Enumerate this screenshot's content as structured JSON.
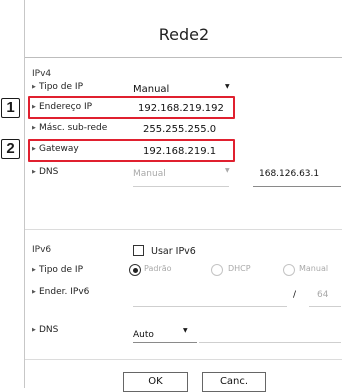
{
  "title": "Rede2",
  "ipv4": {
    "section_label": "IPv4",
    "ip_type": {
      "label": "Tipo de IP",
      "value": "Manual"
    },
    "ip_address": {
      "label": "Endereço IP",
      "value": "192.168.219.192"
    },
    "subnet_mask": {
      "label": "Másc. sub-rede",
      "value": "255.255.255.0"
    },
    "gateway": {
      "label": "Gateway",
      "value": "192.168.219.1"
    },
    "dns": {
      "label": "DNS",
      "mode": "Manual",
      "value": "168.126.63.1"
    }
  },
  "callouts": {
    "one": "1",
    "two": "2"
  },
  "ipv6": {
    "section_label": "IPv6",
    "use_label": "Usar IPv6",
    "use_checked": false,
    "ip_type": {
      "label": "Tipo de IP",
      "options": [
        "Padrão",
        "DHCP",
        "Manual"
      ],
      "selected": "Padrão"
    },
    "address": {
      "label": "Ender. IPv6",
      "value": "",
      "prefix_separator": "/",
      "prefix": "64"
    },
    "dns": {
      "label": "DNS",
      "value": "Auto"
    }
  },
  "buttons": {
    "ok": "OK",
    "cancel": "Canc."
  },
  "icons": {
    "dropdown": "chevron-down-icon",
    "bullet": "triangle-right-icon"
  },
  "colors": {
    "highlight": "#e0202f",
    "disabled": "#a9a9a9"
  }
}
